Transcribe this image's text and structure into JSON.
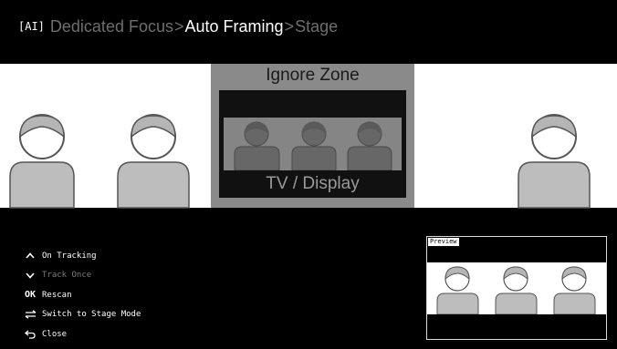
{
  "header": {
    "ai_badge": "[AI]",
    "crumb_1": "Dedicated Focus",
    "separator_1": ">",
    "crumb_2": "Auto Framing",
    "separator_2": ">",
    "crumb_3": "Stage"
  },
  "scene": {
    "ignore_zone_title": "Ignore Zone",
    "tv_label": "TV / Display"
  },
  "controls": [
    {
      "icon": "up-chevron-icon",
      "label": "On Tracking",
      "enabled": true
    },
    {
      "icon": "down-chevron-icon",
      "label": "Track Once",
      "enabled": false
    },
    {
      "icon": "ok-icon",
      "icon_text": "OK",
      "label": "Rescan",
      "enabled": true
    },
    {
      "icon": "switch-arrows-icon",
      "label": "Switch to Stage Mode",
      "enabled": true
    },
    {
      "icon": "back-arrow-icon",
      "label": "Close",
      "enabled": true
    }
  ],
  "preview": {
    "label": "Preview"
  },
  "colors": {
    "background": "#000000",
    "stage": "#ffffff",
    "ignore_zone": "#8a8a8a",
    "person_body": "#bdbdbd",
    "dim_text": "#6e6e6e"
  }
}
